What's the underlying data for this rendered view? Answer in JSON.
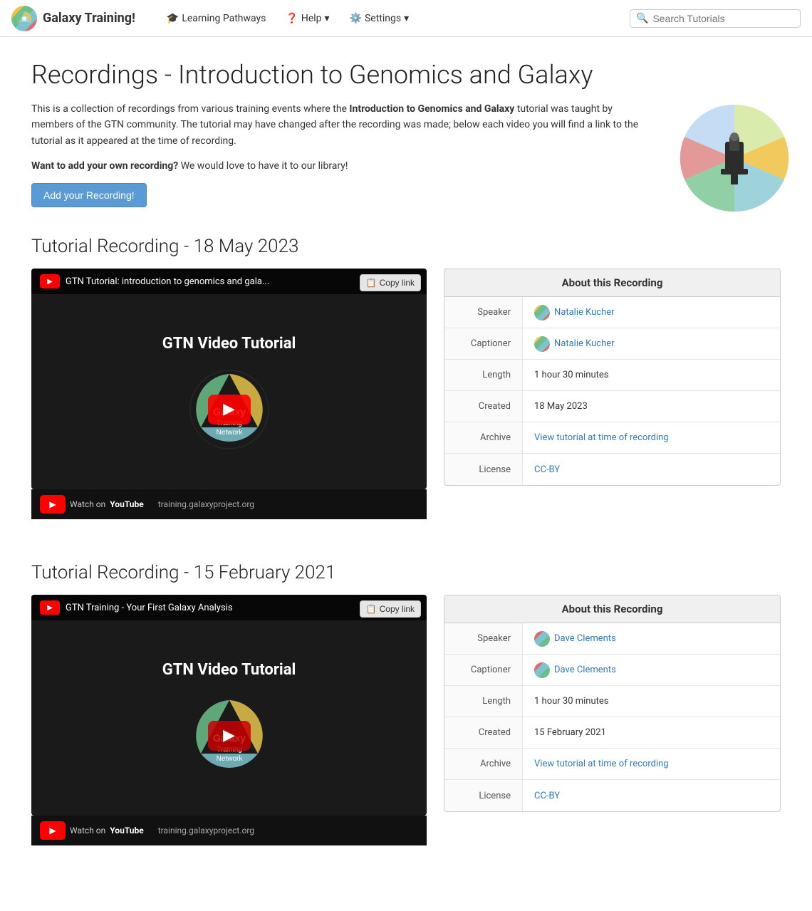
{
  "navbar": {
    "brand": "Galaxy Training!",
    "learning_pathways": "Learning Pathways",
    "help": "Help",
    "settings": "Settings",
    "search_placeholder": "Search Tutorials"
  },
  "page": {
    "title": "Recordings - Introduction to Genomics and Galaxy",
    "intro_before_bold": "This is a collection of recordings from various training events where the ",
    "intro_bold": "Introduction to Genomics and Galaxy",
    "intro_after_bold": " tutorial was taught by members of the GTN community. The tutorial may have changed after the recording was made; below each video you will find a link to the tutorial as it appeared at the time of recording.",
    "want_add_label": "Want to add your own recording?",
    "want_add_text": " We would love to have it to our library!",
    "add_btn": "Add your Recording!"
  },
  "recordings": [
    {
      "section_title": "Tutorial Recording - 18 May 2023",
      "video_title": "GTN Tutorial: introduction to genomics and gala...",
      "video_label": "GTN Video Tutorial",
      "copy_label": "Copy link",
      "watch_on": "Watch on",
      "youtube": "YouTube",
      "url": "training.galaxyproject.org",
      "about_header": "About this Recording",
      "speaker_label": "Speaker",
      "speaker_name": "Natalie Kucher",
      "speaker_link": "#",
      "captioner_label": "Captioner",
      "captioner_name": "Natalie Kucher",
      "captioner_link": "#",
      "length_label": "Length",
      "length_value": "1 hour 30 minutes",
      "created_label": "Created",
      "created_value": "18 May 2023",
      "archive_label": "Archive",
      "archive_text": "View tutorial at time of recording",
      "archive_link": "#",
      "license_label": "License",
      "license_text": "CC-BY",
      "license_link": "#"
    },
    {
      "section_title": "Tutorial Recording - 15 February 2021",
      "video_title": "GTN Training - Your First Galaxy Analysis",
      "video_label": "GTN Video Tutorial",
      "copy_label": "Copy link",
      "watch_on": "Watch on",
      "youtube": "YouTube",
      "url": "training.galaxyproject.org",
      "about_header": "About this Recording",
      "speaker_label": "Speaker",
      "speaker_name": "Dave Clements",
      "speaker_link": "#",
      "captioner_label": "Captioner",
      "captioner_name": "Dave Clements",
      "captioner_link": "#",
      "length_label": "Length",
      "length_value": "1 hour 30 minutes",
      "created_label": "Created",
      "created_value": "15 February 2021",
      "archive_label": "Archive",
      "archive_text": "View tutorial at time of recording",
      "archive_link": "#",
      "license_label": "License",
      "license_text": "CC-BY",
      "license_link": "#"
    }
  ]
}
